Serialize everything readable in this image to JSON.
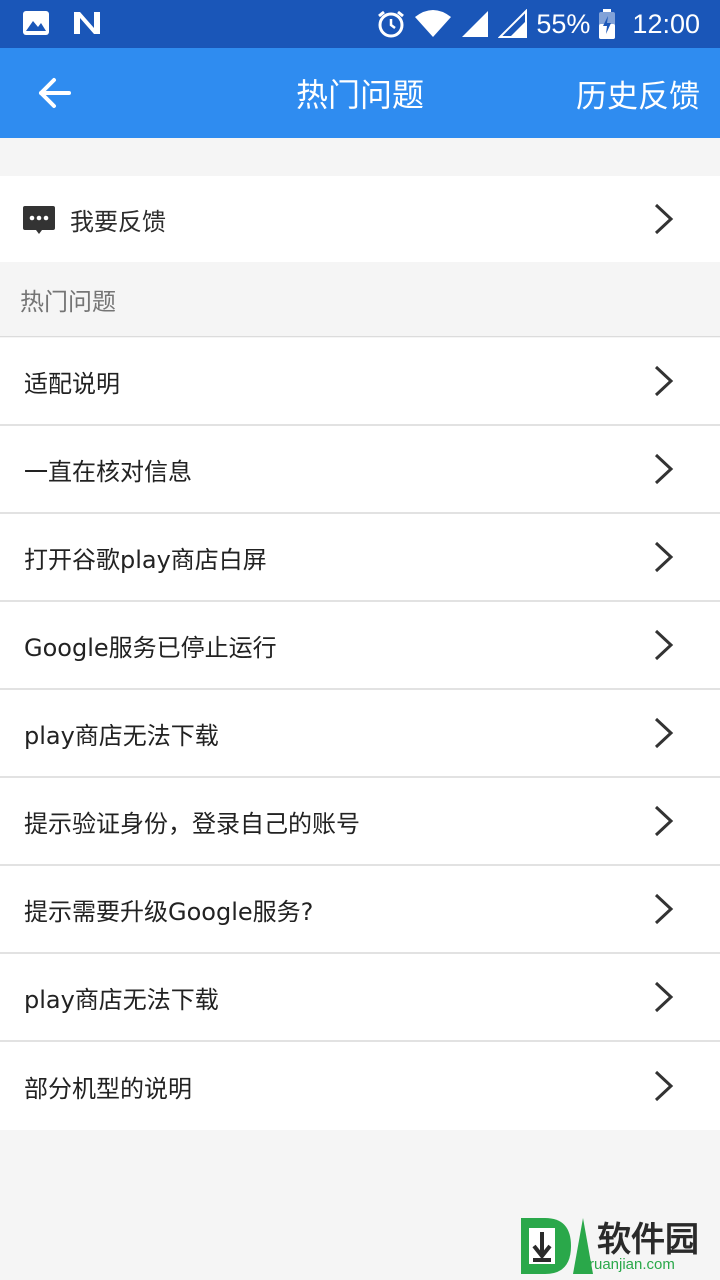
{
  "status_bar": {
    "battery_percent": "55%",
    "time": "12:00"
  },
  "app_bar": {
    "title": "热门问题",
    "history_label": "历史反馈"
  },
  "feedback": {
    "label": "我要反馈"
  },
  "section": {
    "header": "热门问题"
  },
  "faq_items": [
    "适配说明",
    "一直在核对信息",
    "打开谷歌play商店白屏",
    "Google服务已停止运行",
    "play商店无法下载",
    "提示验证身份，登录自己的账号",
    "提示需要升级Google服务?",
    "play商店无法下载",
    "部分机型的说明"
  ],
  "watermark": {
    "text": "软件园",
    "domain": "ruanjian.com"
  },
  "colors": {
    "status_bar": "#1a56b8",
    "app_bar": "#2f8cf0",
    "background": "#f5f5f5",
    "row": "#ffffff"
  }
}
